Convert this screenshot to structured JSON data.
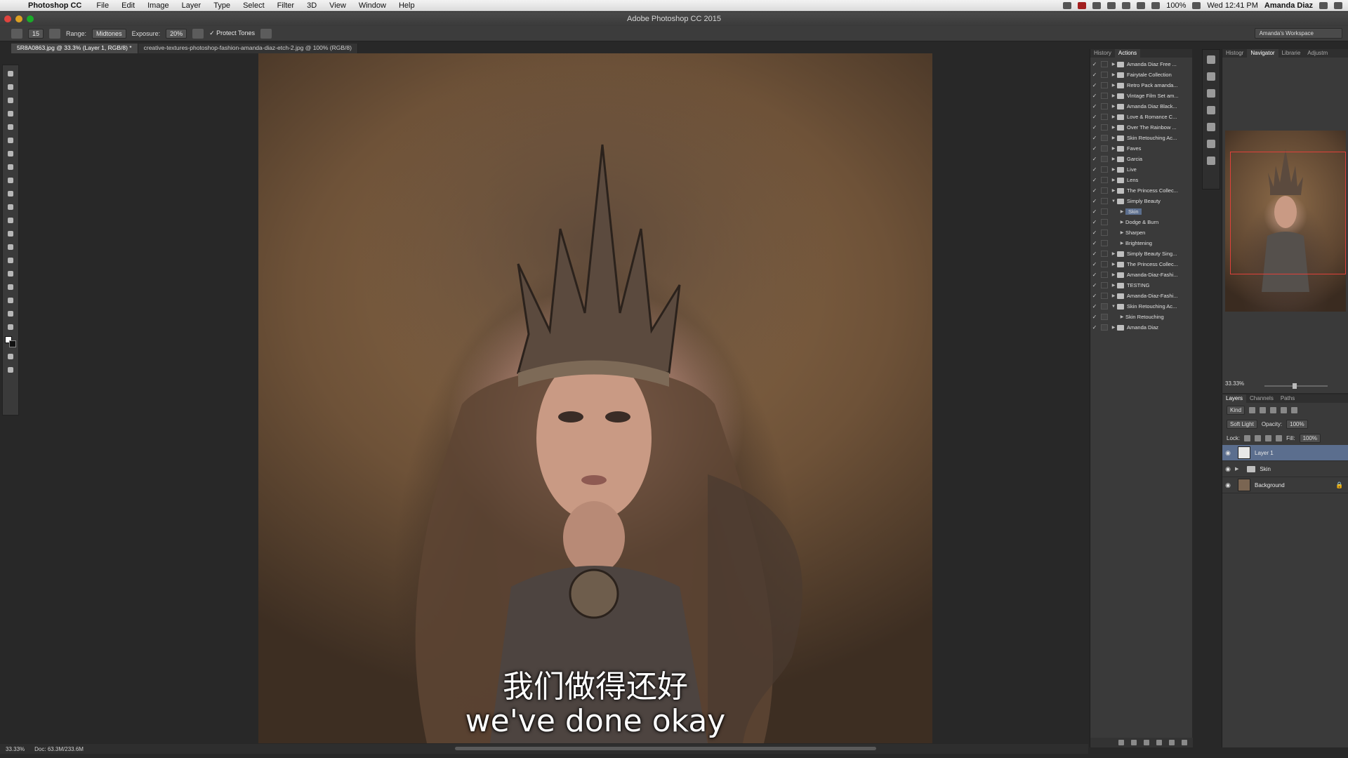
{
  "menubar": {
    "apple_icon": "apple-logo-icon",
    "app_name": "Photoshop CC",
    "items": [
      "File",
      "Edit",
      "Image",
      "Layer",
      "Type",
      "Select",
      "Filter",
      "3D",
      "View",
      "Window",
      "Help"
    ],
    "battery": "100%",
    "clock": "Wed 12:41 PM",
    "user": "Amanda Diaz"
  },
  "window": {
    "title": "Adobe Photoshop CC 2015"
  },
  "options_bar": {
    "brush_size": "15",
    "range_label": "Range:",
    "range_value": "Midtones",
    "exposure_label": "Exposure:",
    "exposure_value": "20%",
    "protect_tones_label": "Protect Tones",
    "workspace": "Amanda's Workspace"
  },
  "document_tabs": [
    {
      "label": "5R8A0863.jpg @ 33.3% (Layer 1, RGB/8) *",
      "active": true
    },
    {
      "label": "creative-textures-photoshop-fashion-amanda-diaz-etch-2.jpg @ 100% (RGB/8)",
      "active": false
    }
  ],
  "subtitles": {
    "zh": "我们做得还好",
    "en": "we've done okay"
  },
  "status_bar": {
    "zoom": "33.33%",
    "doc_size": "Doc: 63.3M/233.6M"
  },
  "actions_panel": {
    "tabs": [
      "History",
      "Actions"
    ],
    "active_tab": "Actions",
    "items": [
      {
        "name": "Amanda Diaz Free ...",
        "type": "set",
        "expanded": false,
        "dialog": false
      },
      {
        "name": "Fairytale Collection",
        "type": "set",
        "expanded": false,
        "dialog": false
      },
      {
        "name": "Retro Pack amanda...",
        "type": "set",
        "expanded": false,
        "dialog": false
      },
      {
        "name": "Vintage Film Set am...",
        "type": "set",
        "expanded": false,
        "dialog": false
      },
      {
        "name": "Amanda Diaz Black...",
        "type": "set",
        "expanded": false,
        "dialog": false
      },
      {
        "name": "Love & Romance C...",
        "type": "set",
        "expanded": false,
        "dialog": false
      },
      {
        "name": "Over The Rainbow ...",
        "type": "set",
        "expanded": false,
        "dialog": false
      },
      {
        "name": "Skin Retouching Ac...",
        "type": "set",
        "expanded": false,
        "dialog": true
      },
      {
        "name": "Faves",
        "type": "set",
        "expanded": false,
        "dialog": true
      },
      {
        "name": "Garcia",
        "type": "set",
        "expanded": false,
        "dialog": true
      },
      {
        "name": "Live",
        "type": "set",
        "expanded": false,
        "dialog": false
      },
      {
        "name": "Lens",
        "type": "set",
        "expanded": false,
        "dialog": false
      },
      {
        "name": "The Princess Collec...",
        "type": "set",
        "expanded": false,
        "dialog": false
      },
      {
        "name": "Simply Beauty",
        "type": "set",
        "expanded": true,
        "dialog": false
      },
      {
        "name": "Skin",
        "type": "action",
        "expanded": false,
        "dialog": false,
        "selected": true
      },
      {
        "name": "Dodge & Burn",
        "type": "action",
        "expanded": false,
        "dialog": false
      },
      {
        "name": "Sharpen",
        "type": "action",
        "expanded": false,
        "dialog": false
      },
      {
        "name": "Brightening",
        "type": "action",
        "expanded": false,
        "dialog": false
      },
      {
        "name": "Simply Beauty Sing...",
        "type": "set",
        "expanded": false,
        "dialog": false
      },
      {
        "name": "The Princess Collec...",
        "type": "set",
        "expanded": false,
        "dialog": false
      },
      {
        "name": "Amanda-Diaz-Fashi...",
        "type": "set",
        "expanded": false,
        "dialog": false
      },
      {
        "name": "TESTING",
        "type": "set",
        "expanded": false,
        "dialog": false
      },
      {
        "name": "Amanda-Diaz-Fashi...",
        "type": "set",
        "expanded": false,
        "dialog": false
      },
      {
        "name": "Skin Retouching Ac...",
        "type": "set",
        "expanded": true,
        "dialog": true
      },
      {
        "name": "Skin Retouching",
        "type": "action",
        "expanded": false,
        "dialog": true
      },
      {
        "name": "Amanda Diaz",
        "type": "set",
        "expanded": false,
        "dialog": true
      }
    ]
  },
  "navigator_panel": {
    "tabs": [
      "Histogr",
      "Navigator",
      "Librarie",
      "Adjustm"
    ],
    "active_tab": "Navigator",
    "zoom": "33.33%"
  },
  "layers_panel": {
    "tabs": [
      "Layers",
      "Channels",
      "Paths"
    ],
    "active_tab": "Layers",
    "filter_kind": "Kind",
    "blend_mode": "Soft Light",
    "opacity_label": "Opacity:",
    "opacity_value": "100%",
    "lock_label": "Lock:",
    "fill_label": "Fill:",
    "fill_value": "100%",
    "layers": [
      {
        "name": "Layer 1",
        "kind": "pixel",
        "active": true,
        "locked": false
      },
      {
        "name": "Skin",
        "kind": "group",
        "active": false,
        "locked": false
      },
      {
        "name": "Background",
        "kind": "pixel",
        "active": false,
        "locked": true
      }
    ]
  },
  "colors": {
    "accent_selection": "#5b6e8e",
    "panel_bg": "#3a3a3a",
    "chrome_bg": "#282828",
    "nav_view_box": "#e0413a"
  }
}
